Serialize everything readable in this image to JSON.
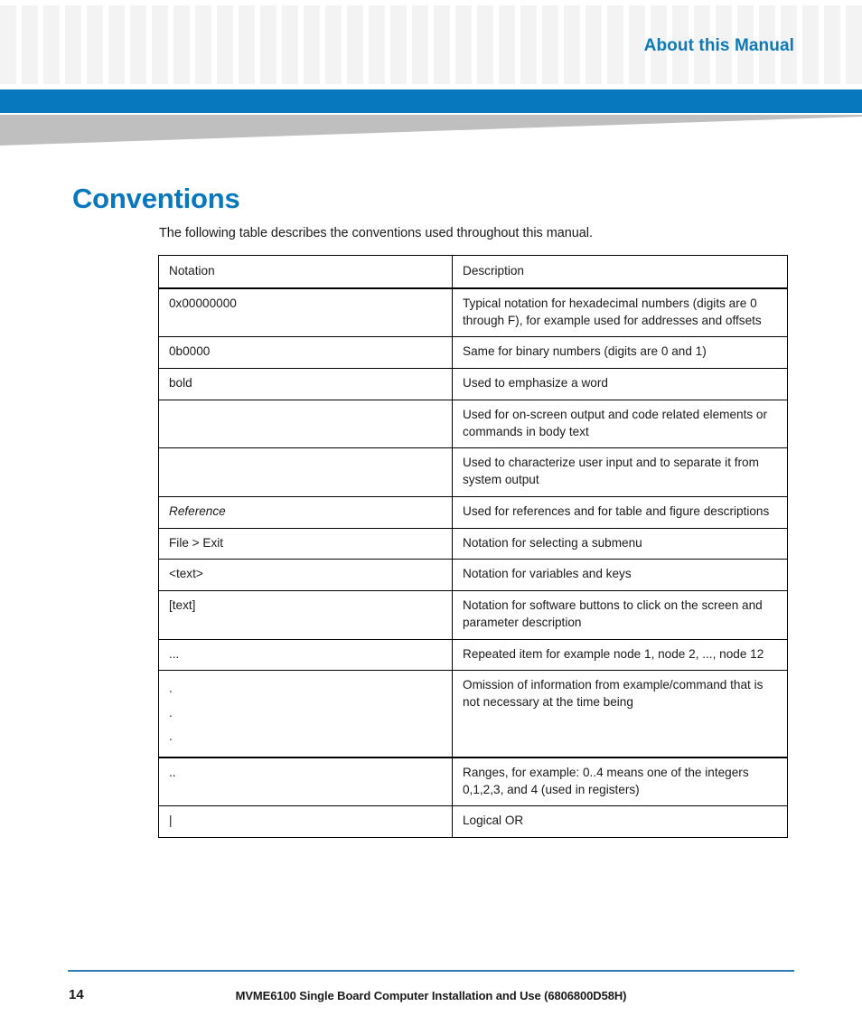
{
  "header": {
    "chapter_title": "About this Manual",
    "accent_blue": "#0878be",
    "title_blue": "#0b7ab9",
    "grid_square_color": "#f3f3f3",
    "wedge_gray": "#bfbfbf"
  },
  "main": {
    "section_title": "Conventions",
    "intro": "The following table describes the conventions used throughout this manual."
  },
  "table": {
    "columns": [
      "Notation",
      "Description"
    ],
    "rows": [
      {
        "notation": "0x00000000",
        "description": "Typical notation for hexadecimal numbers (digits are 0 through F), for example used for addresses and offsets"
      },
      {
        "notation": "0b0000",
        "description": "Same for binary numbers (digits are 0 and 1)"
      },
      {
        "notation": "bold",
        "description": "Used to emphasize a word"
      },
      {
        "notation": "",
        "description": "Used for on-screen output and code related elements or commands in body text"
      },
      {
        "notation": "",
        "description": "Used to characterize user input and to separate it from system output"
      },
      {
        "notation": "Reference",
        "description": "Used for references and for table and figure descriptions"
      },
      {
        "notation": "File > Exit",
        "description": "Notation for selecting a submenu"
      },
      {
        "notation": "<text>",
        "description": "Notation for  variables and keys"
      },
      {
        "notation": "[text]",
        "description": "Notation for software buttons to click on the screen and parameter description"
      },
      {
        "notation": "...",
        "description": "Repeated item for example node 1, node 2, ..., node 12"
      },
      {
        "notation": ".\n.\n.",
        "description": "Omission of information from example/command that is not necessary at the time being"
      },
      {
        "notation": "..",
        "description": "Ranges, for example: 0..4 means one of the integers 0,1,2,3, and 4 (used in registers)"
      },
      {
        "notation": "|",
        "description": "Logical OR"
      }
    ]
  },
  "footer": {
    "page_number": "14",
    "document_title": "MVME6100 Single Board Computer Installation and Use (6806800D58H)"
  }
}
